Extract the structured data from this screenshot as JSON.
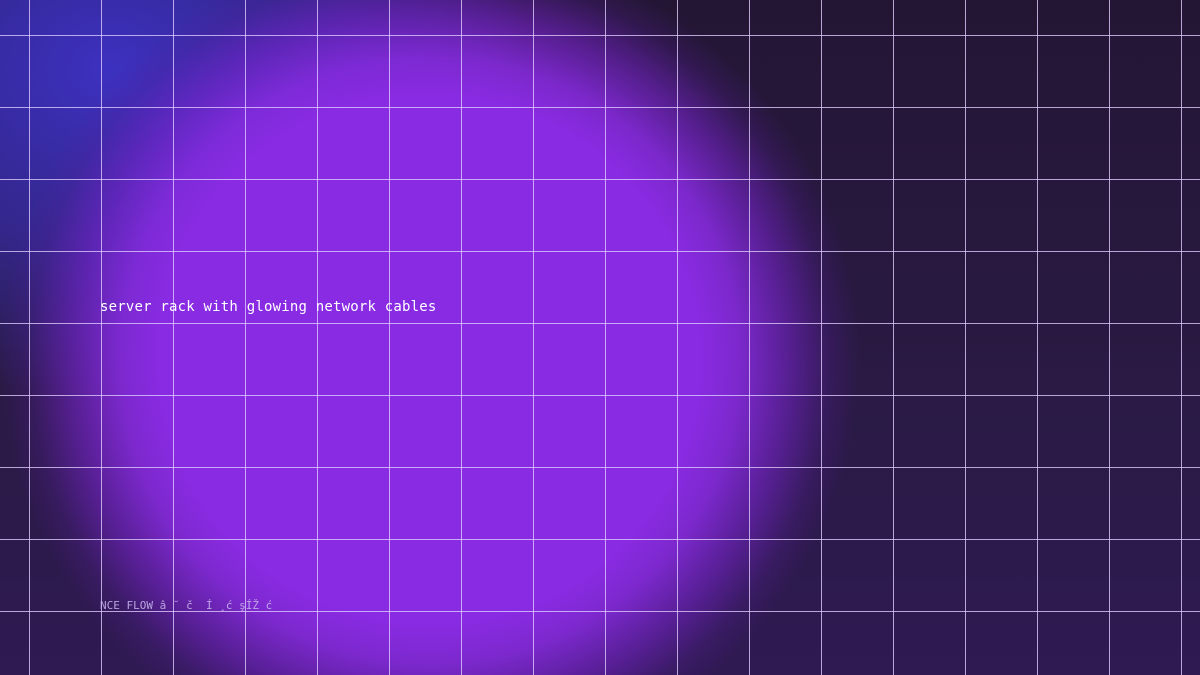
{
  "image_caption": "server rack with glowing network cables",
  "tagline": "NCE FLOW â ˘ č  Í ¸ć şÍŽ ć",
  "colors": {
    "background": "#231634",
    "glow": "#8a2be4",
    "corner_glow": "#3e32c8",
    "grid_lines": "#e1cdff",
    "caption_text": "#ffffff",
    "tagline_text": "#c7b2ec"
  }
}
